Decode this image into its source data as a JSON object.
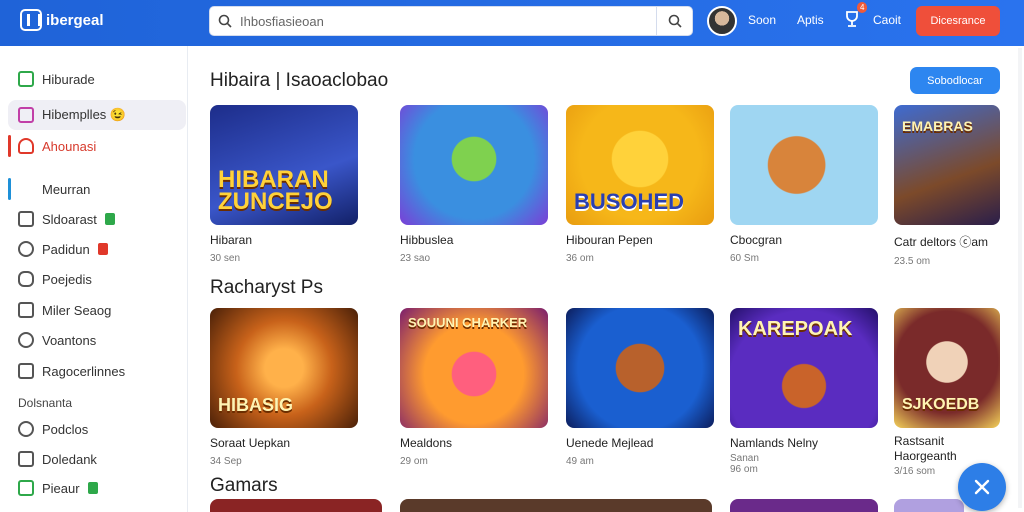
{
  "header": {
    "logo_text": "ibergeal",
    "search_placeholder": "Ihbosfiasieoan",
    "nav": [
      {
        "label": "Soon"
      },
      {
        "label": "Aptis"
      },
      {
        "label": "Caoit"
      }
    ],
    "notification_count": "4",
    "cta_label": "Dicesrance"
  },
  "sidebar": {
    "items": [
      {
        "label": "Hiburade"
      },
      {
        "label": "Hibemplles 😉"
      },
      {
        "label": "Ahounasi"
      },
      {
        "label": "Meurran"
      },
      {
        "label": "Sldoarast"
      },
      {
        "label": "Padidun"
      },
      {
        "label": "Poejedis"
      },
      {
        "label": "Miler Seaog"
      },
      {
        "label": "Voantons"
      },
      {
        "label": "Ragocerlinnes"
      }
    ],
    "section_label": "Dolsnanta",
    "sub_items": [
      {
        "label": "Podclos"
      },
      {
        "label": "Doledank"
      },
      {
        "label": "Pieaur"
      }
    ]
  },
  "main": {
    "sections": [
      {
        "title": "Hibaira | Isaoaclobao",
        "action": "Sobodlocar",
        "cards": [
          {
            "name": "Hibaran",
            "meta": "30 sen",
            "thumb_text": "HIBARAN ZUNCEJO"
          },
          {
            "name": "Hibbuslea",
            "meta": "23 sao",
            "thumb_text": ""
          },
          {
            "name": "Hibouran Pepen",
            "meta": "36 om",
            "thumb_text": "BUSOHED"
          },
          {
            "name": "Cbocgran",
            "meta": "60 Sm",
            "thumb_text": ""
          },
          {
            "name": "Catr deltors  ⓒam",
            "meta": "23.5 om",
            "thumb_text": "EMABRAS"
          }
        ]
      },
      {
        "title": "Racharyst Ps",
        "action": "",
        "cards": [
          {
            "name": "Soraat Uepkan",
            "meta": "34 Sep",
            "thumb_text": "HIBASIG"
          },
          {
            "name": "Mealdons",
            "meta": "29 om",
            "thumb_text": "SOUUNI CHARKER"
          },
          {
            "name": "Uenede Mejlead",
            "meta": "49 am",
            "thumb_text": ""
          },
          {
            "name": "Namlands Nelny",
            "meta": "Sanan\n96 om",
            "thumb_text": "KAREPOAK"
          },
          {
            "name": "Rastsanit\nHaorgeanth",
            "meta": "3/16 som",
            "thumb_text": "SJKOEDB"
          }
        ]
      },
      {
        "title": "Gamars",
        "action": "",
        "cards": []
      }
    ]
  },
  "colors": {
    "topbar": "#2068df",
    "accent": "#2d86f0",
    "cta": "#ef4f3a"
  }
}
